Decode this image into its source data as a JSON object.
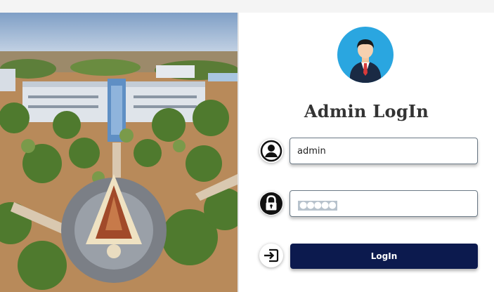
{
  "login": {
    "title": "Admin LogIn",
    "username_value": "admin",
    "password_mask": "●●●●●",
    "button_label": "LogIn"
  },
  "icons": {
    "avatar": "admin-avatar-icon",
    "username": "user-circle-icon",
    "password": "padlock-icon",
    "login": "sign-in-icon"
  },
  "colors": {
    "avatar_bg": "#2aa6e0",
    "button_bg": "#0c1a4e",
    "button_text": "#ffffff",
    "title_text": "#333333"
  }
}
